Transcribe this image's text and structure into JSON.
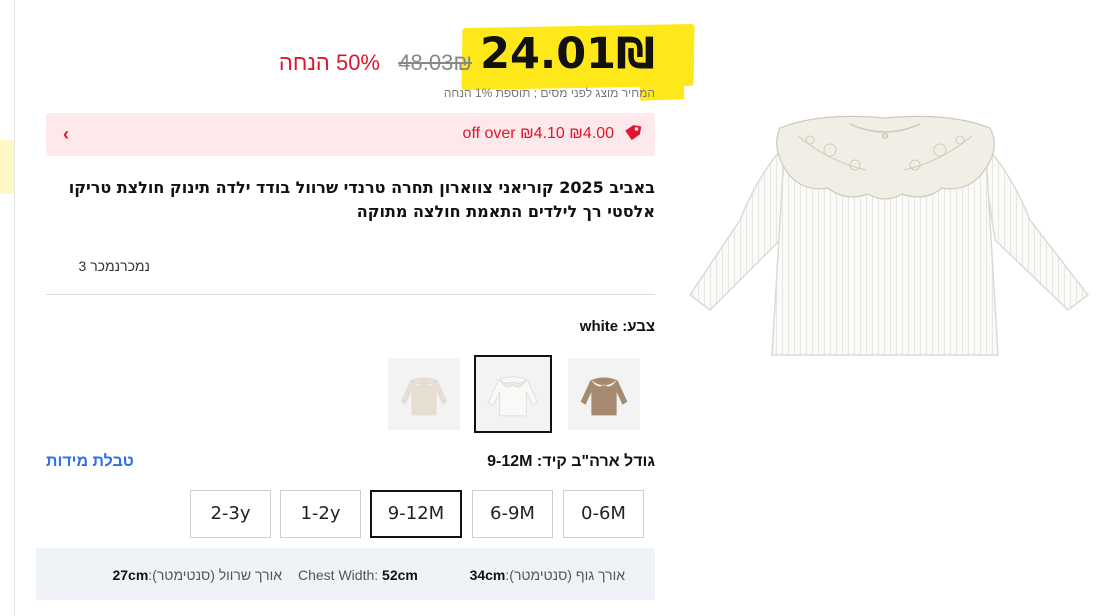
{
  "price": {
    "current": "24.01₪",
    "original": "48.03₪",
    "discount": "50% הנחה",
    "tax_note": "המחיר מוצג לפני מסים ; תוספת 1% הנחה"
  },
  "coupon": {
    "text": "₪4.00 ₪4.10 off over",
    "icon": "tag-icon",
    "chevron": "‹",
    "color": "#e0152e",
    "background": "#fde9eb"
  },
  "product": {
    "title": "באביב 2025 קוריאני צווארון תחרה טרנדי שרוול בודד ילדה תינוק חולצת טריקו אלסטי רך לילדים התאמת חולצה מתוקה",
    "sold": "נמכרנמכר 3"
  },
  "color": {
    "label": "צבע: white",
    "swatches": [
      {
        "name": "brown",
        "selected": false
      },
      {
        "name": "white",
        "selected": true
      },
      {
        "name": "beige",
        "selected": false
      }
    ]
  },
  "size": {
    "label": "גודל ארה\"ב קיד: 9-12M",
    "chart_link": "טבלת מידות",
    "options": [
      "0-6M",
      "6-9M",
      "9-12M",
      "1-2y",
      "2-3y"
    ],
    "selected": "9-12M"
  },
  "measurements": {
    "body_length_label": "אורך גוף (סנטימטר):",
    "body_length_value": "34cm",
    "chest_label": "Chest Width:",
    "chest_value": "52cm",
    "sleeve_label": "אורך שרוול (סנטימטר):",
    "sleeve_value": "27cm"
  },
  "colors": {
    "highlight": "#ffe81a",
    "sale_red": "#e0152e",
    "link_blue": "#2f6fe4"
  }
}
